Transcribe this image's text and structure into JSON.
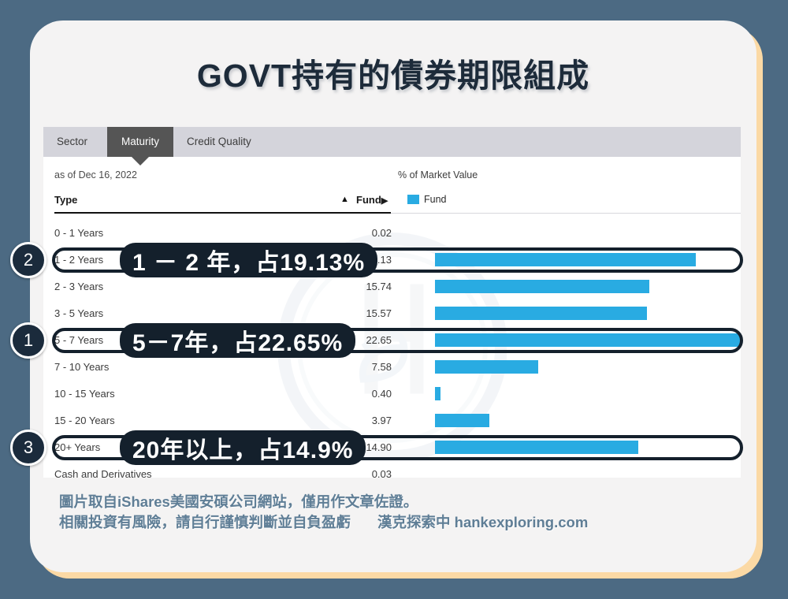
{
  "theme": {
    "background": "#4c6a83",
    "card": "#f4f3f3",
    "card_shadow": "#fbd9a5",
    "title_color": "#1d2b3a",
    "bar_color": "#29abe2",
    "tabbar_bg": "#d4d4db",
    "active_tab_bg": "#555555",
    "annotation_color": "#14202c",
    "badge_color": "#1b2b3c",
    "footer_color": "#5f7e96"
  },
  "title": "GOVT持有的債券期限組成",
  "panel": {
    "tabs": [
      {
        "label": "Sector",
        "active": false
      },
      {
        "label": "Maturity",
        "active": true
      },
      {
        "label": "Credit Quality",
        "active": false
      }
    ],
    "as_of": "as of Dec 16, 2022",
    "market_value_label": "% of Market Value",
    "columns": {
      "type": "Type",
      "sort_indicator": "▲",
      "fund": "Fund",
      "fund_caret": "▶"
    },
    "legend": {
      "swatch_color": "#29abe2",
      "label": "Fund"
    }
  },
  "chart_data": {
    "type": "bar",
    "title": "GOVT持有的債券期限組成",
    "subtitle": "as of Dec 16, 2022",
    "xlabel": "% of Market Value",
    "ylabel": "Type",
    "orientation": "horizontal",
    "grid": false,
    "legend_position": "top-right",
    "xlim": [
      0,
      22.65
    ],
    "series": [
      {
        "name": "Fund",
        "color": "#29abe2",
        "values": [
          0.02,
          19.13,
          15.74,
          15.57,
          22.65,
          7.58,
          0.4,
          3.97,
          14.9,
          0.03
        ]
      }
    ],
    "categories": [
      "0 - 1 Years",
      "1 - 2 Years",
      "2 - 3 Years",
      "3 - 5 Years",
      "5 - 7 Years",
      "7 - 10 Years",
      "10 - 15 Years",
      "15 - 20 Years",
      "20+ Years",
      "Cash and Derivatives"
    ],
    "value_labels": [
      "0.02",
      "19.13",
      "15.74",
      "15.57",
      "22.65",
      "7.58",
      "0.40",
      "3.97",
      "14.90",
      "0.03"
    ],
    "bar_visible": [
      false,
      true,
      true,
      true,
      true,
      true,
      true,
      true,
      true,
      false
    ]
  },
  "rows": [
    {
      "label": "0 - 1 Years",
      "value": "0.02",
      "num": 0.02,
      "bar": false
    },
    {
      "label": "1 - 2 Years",
      "value": "19.13",
      "num": 19.13,
      "bar": true
    },
    {
      "label": "2 - 3 Years",
      "value": "15.74",
      "num": 15.74,
      "bar": true
    },
    {
      "label": "3 - 5 Years",
      "value": "15.57",
      "num": 15.57,
      "bar": true
    },
    {
      "label": "5 - 7 Years",
      "value": "22.65",
      "num": 22.65,
      "bar": true
    },
    {
      "label": "7 - 10 Years",
      "value": "7.58",
      "num": 7.58,
      "bar": true
    },
    {
      "label": "10 - 15 Years",
      "value": "0.40",
      "num": 0.4,
      "bar": true
    },
    {
      "label": "15 - 20 Years",
      "value": "3.97",
      "num": 3.97,
      "bar": true
    },
    {
      "label": "20+ Years",
      "value": "14.90",
      "num": 14.9,
      "bar": true
    },
    {
      "label": "Cash and Derivatives",
      "value": "0.03",
      "num": 0.03,
      "bar": false
    }
  ],
  "annotations": [
    {
      "badge": "1",
      "text": "5－7年，占22.65%",
      "row_index": 4
    },
    {
      "badge": "2",
      "text": "1 － 2 年，占19.13%",
      "row_index": 1
    },
    {
      "badge": "3",
      "text": "20年以上，占14.9%",
      "row_index": 8
    }
  ],
  "footer": {
    "line1": "圖片取自iShares美國安碩公司網站，僅用作文章佐證。",
    "line2": "相關投資有風險，請自行謹慎判斷並自負盈虧",
    "brand": "漢克探索中 hankexploring.com"
  }
}
